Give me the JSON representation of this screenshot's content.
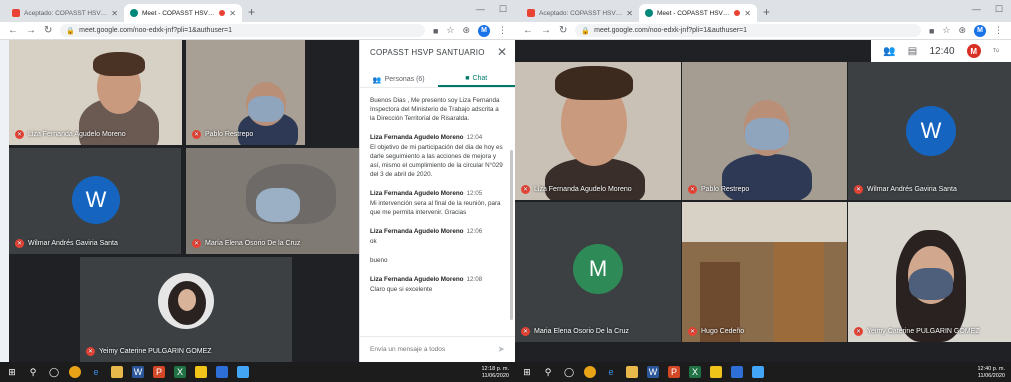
{
  "browser": {
    "tabs": [
      {
        "title": "Aceptado: COPASST HSVP SANTUARIO",
        "icon": "gmail-icon",
        "active": false
      },
      {
        "title": "Meet - COPASST HSVP SANTUARIO",
        "icon": "meet-icon",
        "active": true
      }
    ],
    "url": "meet.google.com/noo-edxk-jnf?pli=1&authuser=1",
    "profile_initial": "M"
  },
  "meeting": {
    "time": "12:40",
    "self_initial": "M",
    "self_tag": "Tú"
  },
  "left_tiles": [
    {
      "name": "Liza Fernanda Agudelo Moreno"
    },
    {
      "name": "Pablo Restrepo"
    },
    {
      "name": "Wilmar Andrés Gaviria Santa",
      "initial": "W"
    },
    {
      "name": "María Elena Osorio De la Cruz"
    },
    {
      "name": "Yeimy Caterine PULGARIN GOMEZ"
    }
  ],
  "right_tiles": [
    {
      "name": "Liza Fernanda Agudelo Moreno"
    },
    {
      "name": "Pablo Restrepo"
    },
    {
      "name": "Wilmar Andrés Gaviria Santa",
      "initial": "W"
    },
    {
      "name": "Maria Elena Osorio De la Cruz",
      "initial": "M"
    },
    {
      "name": "Hugo Cedeño"
    },
    {
      "name": "Yeimy Caterine PULGARIN GOMEZ"
    }
  ],
  "chat": {
    "title": "COPASST HSVP SANTUARIO",
    "tab_people": "Personas (6)",
    "tab_chat": "Chat",
    "messages": [
      {
        "author": "",
        "time": "",
        "text": "Buenos Dias , Me presento soy Liza Fernanda Inspectora del Ministerio de Trabajo adscrita a la Dirección Territorial de Risaralda."
      },
      {
        "author": "Liza Fernanda Agudelo Moreno",
        "time": "12:04",
        "text": "El objetivo de mi participación del dia de hoy es darle seguimiento a las acciones de mejora y así, mismo el cumplimiento de la circular N°029 del 3 de abril de 2020."
      },
      {
        "author": "Liza Fernanda Agudelo Moreno",
        "time": "12:05",
        "text": "Mi intervención sera al final de la reunión, para que me permita intervenir. Gracias"
      },
      {
        "author": "Liza Fernanda Agudelo Moreno",
        "time": "12:06",
        "text": "ok"
      },
      {
        "author": "",
        "time": "",
        "text": "bueno"
      },
      {
        "author": "Liza Fernanda Agudelo Moreno",
        "time": "12:08",
        "text": "Claro que si excelente"
      }
    ],
    "input_placeholder": "Envía un mensaje a todos"
  },
  "taskbar": {
    "clock_left": {
      "time": "12:18 p. m.",
      "date": "11/06/2020"
    },
    "clock_right": {
      "time": "12:40 p. m.",
      "date": "11/06/2020"
    }
  },
  "colors": {
    "meet_green": "#00796b",
    "avatar_blue": "#1565c0",
    "avatar_green": "#2e8b57",
    "mic_off_red": "#ea4335"
  }
}
